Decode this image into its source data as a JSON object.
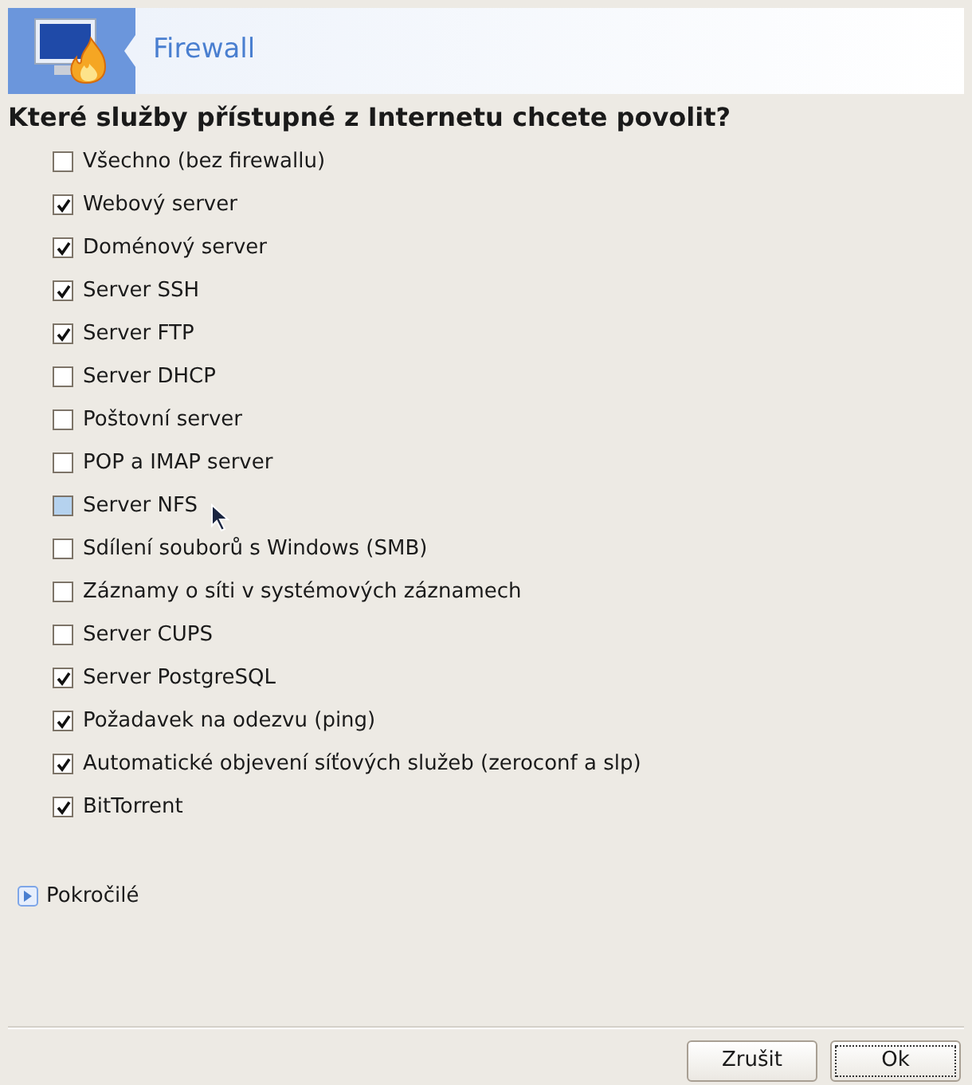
{
  "header": {
    "title": "Firewall"
  },
  "question": "Které služby přístupné z Internetu chcete povolit?",
  "services": [
    {
      "label": "Všechno (bez firewallu)",
      "checked": false,
      "hovered": false
    },
    {
      "label": "Webový server",
      "checked": true,
      "hovered": false
    },
    {
      "label": "Doménový server",
      "checked": true,
      "hovered": false
    },
    {
      "label": "Server SSH",
      "checked": true,
      "hovered": false
    },
    {
      "label": "Server FTP",
      "checked": true,
      "hovered": false
    },
    {
      "label": "Server DHCP",
      "checked": false,
      "hovered": false
    },
    {
      "label": "Poštovní server",
      "checked": false,
      "hovered": false
    },
    {
      "label": "POP a IMAP server",
      "checked": false,
      "hovered": false
    },
    {
      "label": "Server NFS",
      "checked": false,
      "hovered": true
    },
    {
      "label": "Sdílení souborů s Windows (SMB)",
      "checked": false,
      "hovered": false
    },
    {
      "label": "Záznamy o síti v systémových záznamech",
      "checked": false,
      "hovered": false
    },
    {
      "label": "Server CUPS",
      "checked": false,
      "hovered": false
    },
    {
      "label": "Server PostgreSQL",
      "checked": true,
      "hovered": false
    },
    {
      "label": "Požadavek na odezvu (ping)",
      "checked": true,
      "hovered": false
    },
    {
      "label": "Automatické objevení síťových služeb (zeroconf a slp)",
      "checked": true,
      "hovered": false
    },
    {
      "label": "BitTorrent",
      "checked": true,
      "hovered": false
    }
  ],
  "advanced": {
    "label": "Pokročilé",
    "expanded": false
  },
  "buttons": [
    {
      "label": "Zrušit",
      "focused": false
    },
    {
      "label": "Ok",
      "focused": true
    }
  ]
}
